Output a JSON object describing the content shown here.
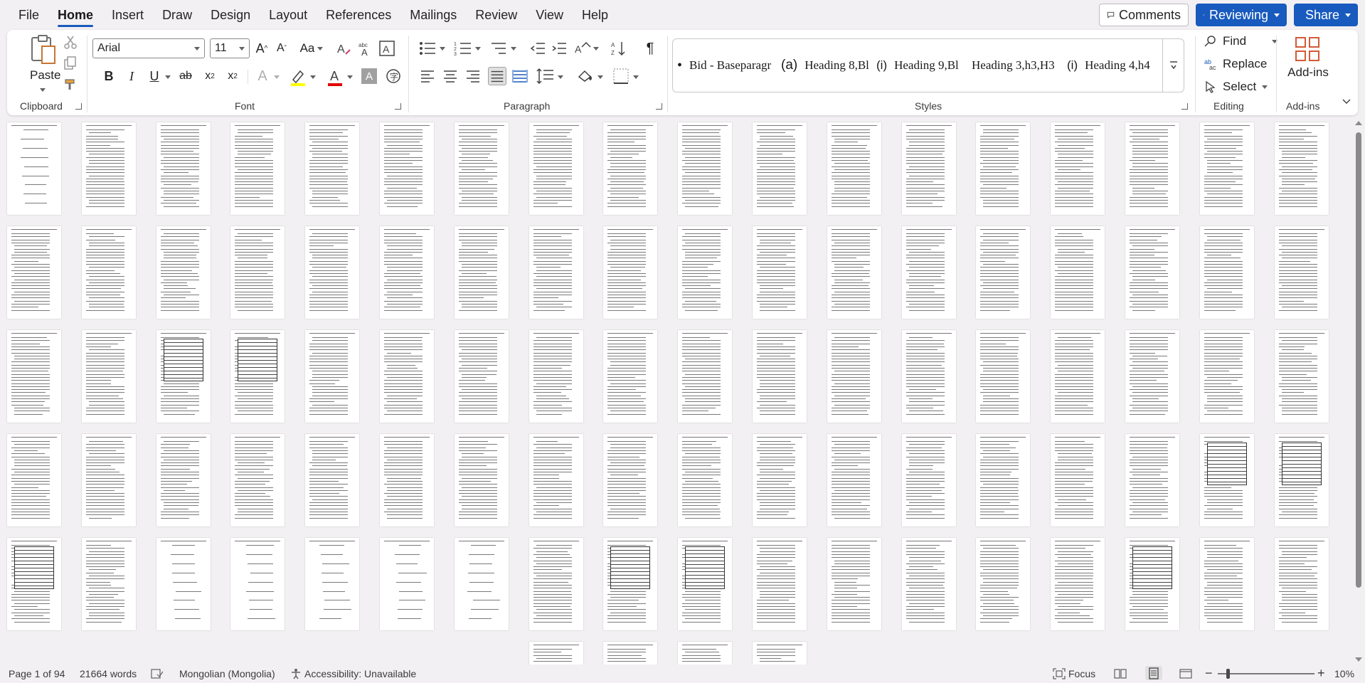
{
  "menu": {
    "items": [
      "File",
      "Home",
      "Insert",
      "Draw",
      "Design",
      "Layout",
      "References",
      "Mailings",
      "Review",
      "View",
      "Help"
    ],
    "active": "Home",
    "comments_label": "Comments",
    "reviewing_label": "Reviewing",
    "share_label": "Share"
  },
  "ribbon": {
    "clipboard": {
      "paste_label": "Paste",
      "group_label": "Clipboard"
    },
    "font": {
      "name": "Arial",
      "size": "11",
      "group_label": "Font",
      "change_case_label": "Aa",
      "bold": "B",
      "italic": "I",
      "underline": "U",
      "strike": "ab",
      "subscript": "x",
      "superscript": "x",
      "sub_mark": "2",
      "sup_mark": "2",
      "highlight_color": "#ffff00",
      "font_color": "#e00000"
    },
    "paragraph": {
      "group_label": "Paragraph",
      "pilcrow": "¶"
    },
    "styles": {
      "group_label": "Styles",
      "items": [
        {
          "marker": "•",
          "name": "Bid - Baseparagr"
        },
        {
          "marker": "(a)",
          "name": "Heading 8,Bl"
        },
        {
          "marker": "(i)",
          "name": "Heading 9,Bl"
        },
        {
          "marker": "",
          "name": "Heading 3,h3,H3"
        },
        {
          "marker": "(i)",
          "name": "Heading 4,h4"
        }
      ]
    },
    "editing": {
      "group_label": "Editing",
      "find_label": "Find",
      "replace_label": "Replace",
      "select_label": "Select"
    },
    "addins": {
      "label": "Add-ins",
      "group_label": "Add-ins"
    }
  },
  "statusbar": {
    "page": "Page 1 of 94",
    "words": "21664 words",
    "language": "Mongolian (Mongolia)",
    "accessibility": "Accessibility: Unavailable",
    "focus_label": "Focus",
    "zoom_minus": "−",
    "zoom_plus": "+",
    "zoom": "10%"
  },
  "colors": {
    "accent": "#185abd",
    "background": "#f3f0f3",
    "ribbon": "#ffffff",
    "addins_icon": "#d25a35"
  }
}
